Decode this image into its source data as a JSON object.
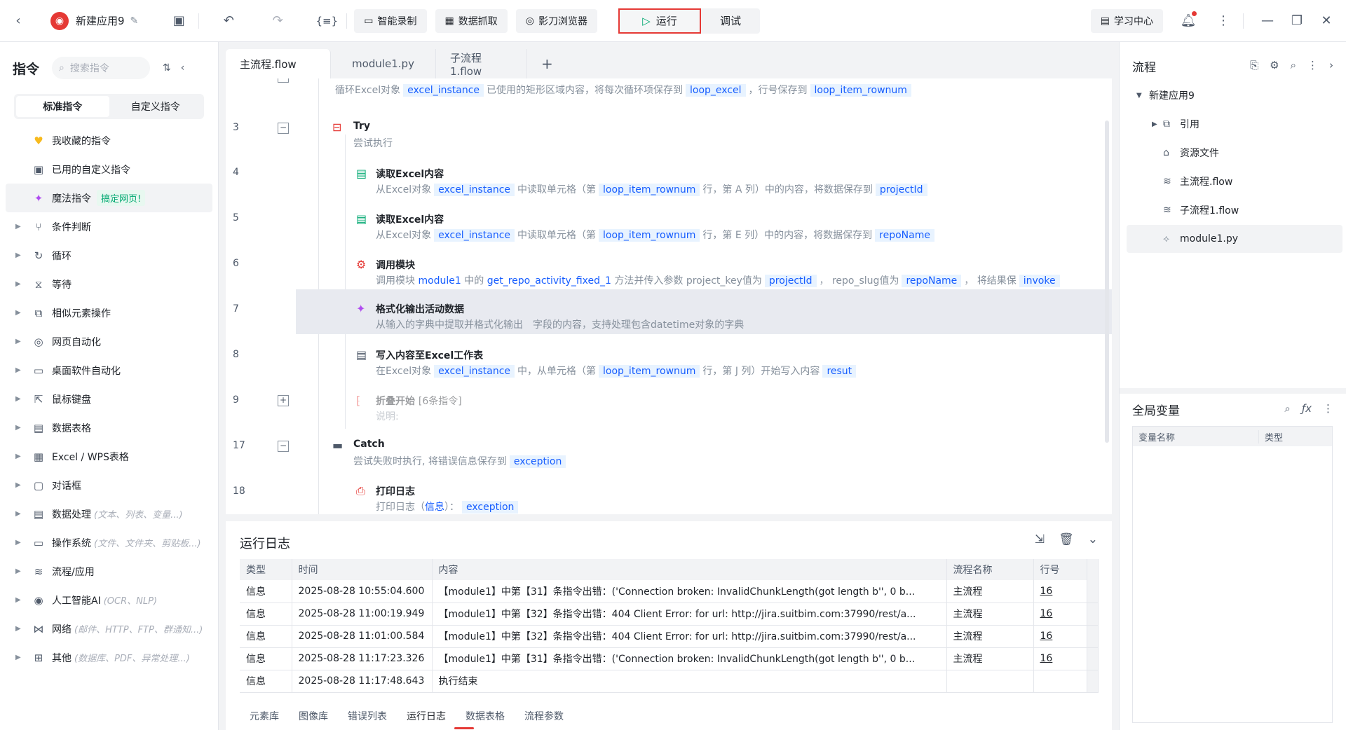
{
  "app": {
    "name": "新建应用9"
  },
  "toolbar": {
    "smart_record": "智能录制",
    "data_grab": "数据抓取",
    "browser": "影刀浏览器",
    "run": "运行",
    "debug": "调试",
    "learn": "学习中心"
  },
  "left": {
    "title": "指令",
    "search_placeholder": "搜索指令",
    "tab_standard": "标准指令",
    "tab_custom": "自定义指令",
    "fav": "我收藏的指令",
    "used_custom": "已用的自定义指令",
    "magic": "魔法指令",
    "magic_badge": "搞定网页!",
    "items": [
      {
        "label": "条件判断",
        "hint": ""
      },
      {
        "label": "循环",
        "hint": ""
      },
      {
        "label": "等待",
        "hint": ""
      },
      {
        "label": "相似元素操作",
        "hint": ""
      },
      {
        "label": "网页自动化",
        "hint": ""
      },
      {
        "label": "桌面软件自动化",
        "hint": ""
      },
      {
        "label": "鼠标键盘",
        "hint": ""
      },
      {
        "label": "数据表格",
        "hint": ""
      },
      {
        "label": "Excel / WPS表格",
        "hint": ""
      },
      {
        "label": "对话框",
        "hint": ""
      },
      {
        "label": "数据处理",
        "hint": "(文本、列表、变量...)"
      },
      {
        "label": "操作系统",
        "hint": "(文件、文件夹、剪贴板...)"
      },
      {
        "label": "流程/应用",
        "hint": ""
      },
      {
        "label": "人工智能AI",
        "hint": "(OCR、NLP)"
      },
      {
        "label": "网络",
        "hint": "(邮件、HTTP、FTP、群通知...)"
      },
      {
        "label": "其他",
        "hint": "(数据库、PDF、异常处理...)"
      }
    ]
  },
  "tabs": [
    "主流程.flow",
    "module1.py",
    "子流程1.flow"
  ],
  "editor": {
    "top": {
      "t1": "循环Excel对象",
      "v1": "excel_instance",
      "t2": "已使用的矩形区域内容，将每次循环项保存到",
      "v2": "loop_excel",
      "t3": "，行号保存到",
      "v3": "loop_item_rownum"
    },
    "lines": [
      "3",
      "4",
      "5",
      "6",
      "7",
      "8",
      "9",
      "17",
      "18"
    ],
    "try_title": "Try",
    "try_desc": "尝试执行",
    "r4": {
      "title": "读取Excel内容",
      "p1": "从Excel对象",
      "v1": "excel_instance",
      "p2": "中读取单元格（第",
      "v2": "loop_item_rownum",
      "p3": "行，第 A 列）中的内容，将数据保存到",
      "v3": "projectId"
    },
    "r5": {
      "title": "读取Excel内容",
      "p1": "从Excel对象",
      "v1": "excel_instance",
      "p2": "中读取单元格（第",
      "v2": "loop_item_rownum",
      "p3": "行，第 E 列）中的内容，将数据保存到",
      "v3": "repoName"
    },
    "r6": {
      "title": "调用模块",
      "p1": "调用模块",
      "b1": "module1",
      "p2": "中的",
      "b2": "get_repo_activity_fixed_1",
      "p3": "方法并传入参数 project_key值为",
      "v1": "projectId",
      "p4": "，  repo_slug值为",
      "v2": "repoName",
      "p5": "，  将结果保",
      "v3": "invoke"
    },
    "r7": {
      "title": "格式化输出活动数据",
      "desc": "从输入的字典中提取并格式化输出　字段的内容，支持处理包含datetime对象的字典"
    },
    "r8": {
      "title": "写入内容至Excel工作表",
      "p1": "在Excel对象",
      "v1": "excel_instance",
      "p2": "中，从单元格（第",
      "v2": "loop_item_rownum",
      "p3": "行，第 J 列）开始写入内容",
      "v3": "resut"
    },
    "r9": {
      "title": "折叠开始",
      "count": "[6条指令]",
      "desc": "说明:"
    },
    "catch_title": "Catch",
    "catch_p1": "尝试失败时执行, 将错误信息保存到",
    "catch_v1": "exception",
    "r18": {
      "title": "打印日志",
      "p1": "打印日志（",
      "b1": "信息",
      "p2": "）：",
      "v1": "exception"
    }
  },
  "log": {
    "title": "运行日志",
    "headers": [
      "类型",
      "时间",
      "内容",
      "流程名称",
      "行号"
    ],
    "rows": [
      [
        "信息",
        "2025-08-28 10:55:04.600",
        "【module1】中第【31】条指令出错：('Connection broken: InvalidChunkLength(got length b'', 0 b...",
        "主流程",
        "16"
      ],
      [
        "信息",
        "2025-08-28 11:00:19.949",
        "【module1】中第【32】条指令出错：404 Client Error:  for url: http://jira.suitbim.com:37990/rest/a...",
        "主流程",
        "16"
      ],
      [
        "信息",
        "2025-08-28 11:01:00.584",
        "【module1】中第【32】条指令出错：404 Client Error:  for url: http://jira.suitbim.com:37990/rest/a...",
        "主流程",
        "16"
      ],
      [
        "信息",
        "2025-08-28 11:17:23.326",
        "【module1】中第【31】条指令出错：('Connection broken: InvalidChunkLength(got length b'', 0 b...",
        "主流程",
        "16"
      ],
      [
        "信息",
        "2025-08-28 11:17:48.643",
        "执行结束",
        "",
        ""
      ]
    ],
    "tabs": [
      "元素库",
      "图像库",
      "错误列表",
      "运行日志",
      "数据表格",
      "流程参数"
    ]
  },
  "right": {
    "title": "流程",
    "tree": [
      "新建应用9",
      "引用",
      "资源文件",
      "主流程.flow",
      "子流程1.flow",
      "module1.py"
    ],
    "vars_title": "全局变量",
    "vars_col1": "变量名称",
    "vars_col2": "类型"
  }
}
